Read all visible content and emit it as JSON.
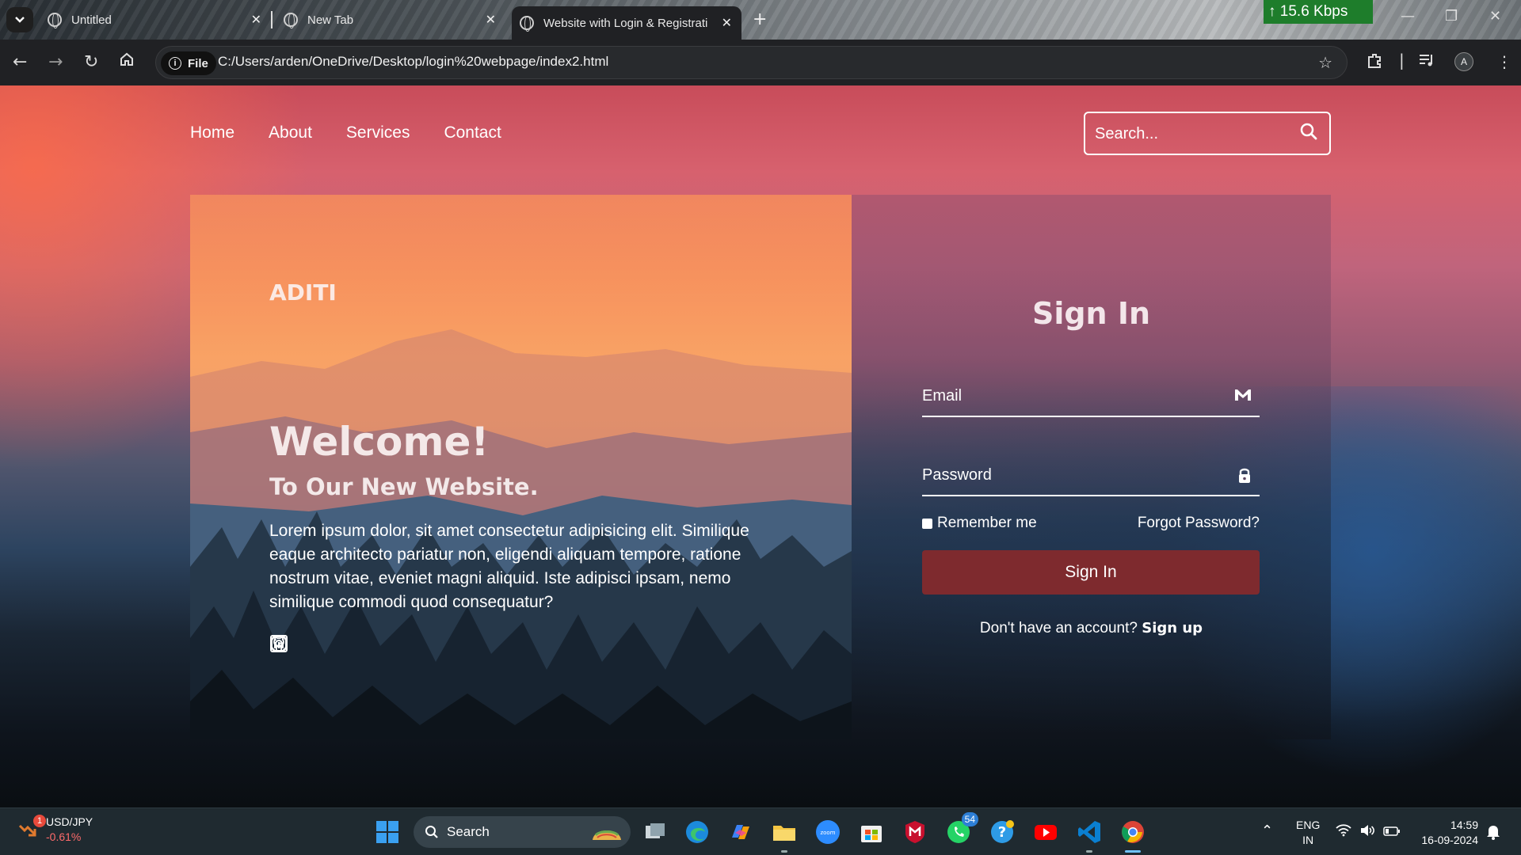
{
  "browser": {
    "tabs": [
      {
        "title": "Untitled",
        "active": false
      },
      {
        "title": "New Tab",
        "active": false
      },
      {
        "title": "Website with Login & Registrati",
        "active": true
      }
    ],
    "new_tab_symbol": "+",
    "network_speed": "↑ 15.6 Kbps",
    "chip_label": "File",
    "url": "C:/Users/arden/OneDrive/Desktop/login%20webpage/index2.html",
    "profile_initial": "A"
  },
  "site": {
    "nav": [
      "Home",
      "About",
      "Services",
      "Contact"
    ],
    "search_placeholder": "Search...",
    "brand": "ADITI",
    "welcome": "Welcome!",
    "subtitle": "To Our New Website.",
    "description": "Lorem ipsum dolor, sit amet consectetur adipisicing elit. Similique eaque architecto pariatur non, eligendi aliquam tempore, ratione nostrum vitae, eveniet magni aliquid. Iste adipisci ipsam, nemo similique commodi quod consequatur?",
    "socials": [
      "linkedin-icon",
      "github-icon",
      "instagram-icon"
    ]
  },
  "login": {
    "title": "Sign In",
    "email_placeholder": "Email",
    "password_placeholder": "Password",
    "remember_label": "Remember me",
    "forgot_label": "Forgot Password?",
    "submit_label": "Sign In",
    "signup_prompt": "Don't have an account?",
    "signup_link": "Sign up"
  },
  "taskbar": {
    "widget_pair": "USD/JPY",
    "widget_change": "-0.61%",
    "widget_badge": "1",
    "search_label": "Search",
    "whatsapp_badge": "54",
    "lang_primary": "ENG",
    "lang_secondary": "IN",
    "time": "14:59",
    "date": "16-09-2024"
  },
  "colors": {
    "signin_button": "#7e2a2e",
    "download_speed_bg": "#1e7d2b",
    "taskbar_bg": "#1f2a30"
  }
}
